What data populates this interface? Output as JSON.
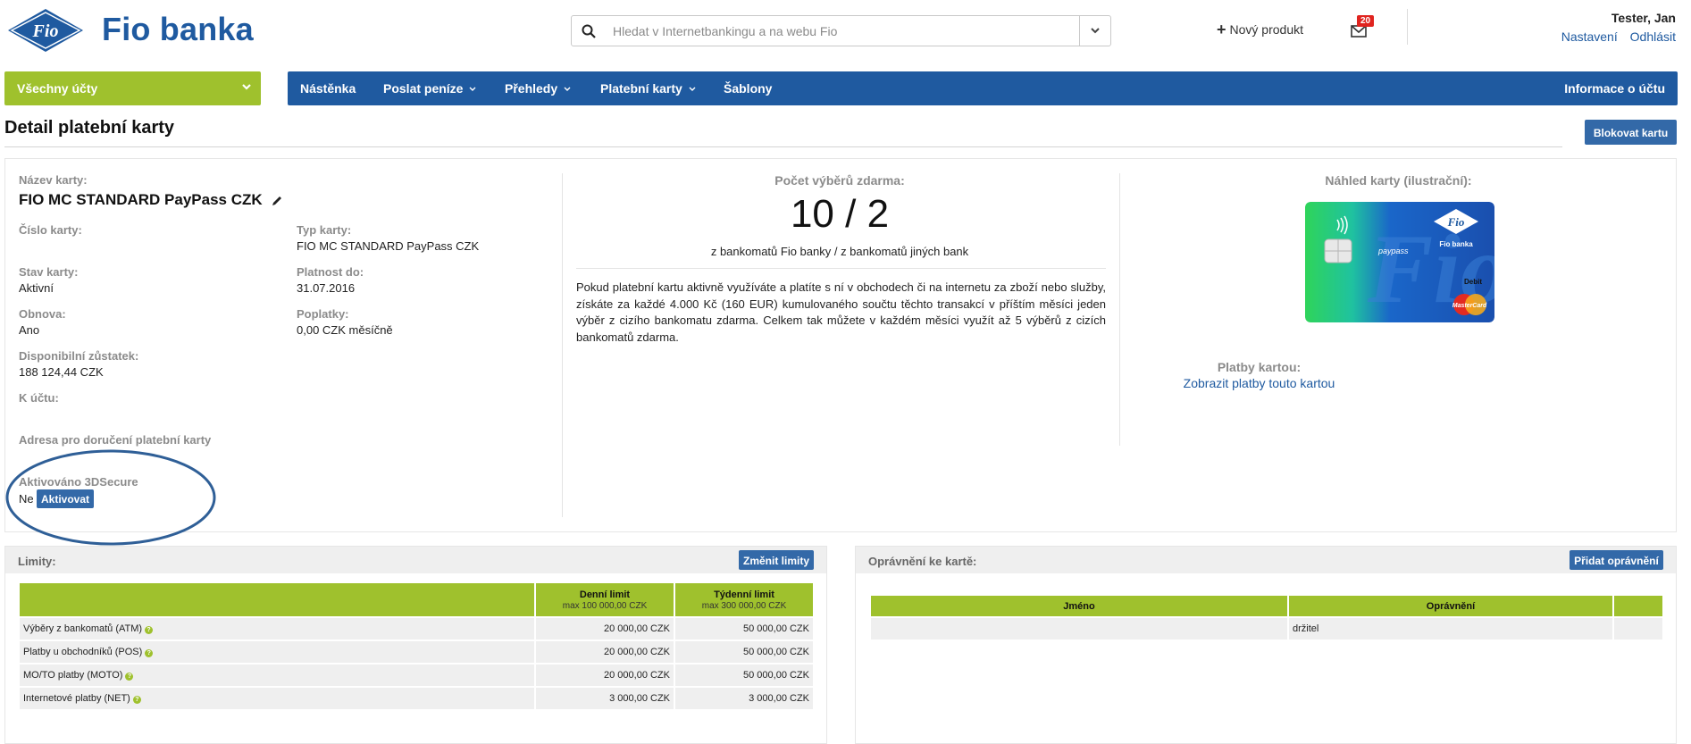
{
  "header": {
    "brand": "Fio banka",
    "logo_text": "Fio",
    "search_placeholder": "Hledat v Internetbankingu a na webu Fio",
    "new_product": "Nový produkt",
    "notifications_count": "20",
    "user_name": "Tester, Jan",
    "settings_link": "Nastavení",
    "logout_link": "Odhlásit"
  },
  "nav": {
    "accounts": "Všechny účty",
    "items": [
      "Nástěnka",
      "Poslat peníze",
      "Přehledy",
      "Platební karty",
      "Šablony"
    ],
    "account_info": "Informace o účtu"
  },
  "page": {
    "title": "Detail platební karty",
    "block_button": "Blokovat kartu"
  },
  "card": {
    "name_label": "Název karty:",
    "name": "FIO MC STANDARD PayPass CZK",
    "number_label": "Číslo karty:",
    "number": "",
    "type_label": "Typ karty:",
    "type": "FIO MC STANDARD PayPass CZK",
    "state_label": "Stav karty:",
    "state": "Aktivní",
    "valid_label": "Platnost do:",
    "valid": "31.07.2016",
    "renew_label": "Obnova:",
    "renew": "Ano",
    "fees_label": "Poplatky:",
    "fees": "0,00 CZK měsíčně",
    "balance_label": "Disponibilní zůstatek:",
    "balance": "188 124,44 CZK",
    "account_label": "K účtu:",
    "address_label": "Adresa pro doručení platební karty",
    "secure_label": "Aktivováno 3DSecure",
    "secure_value": "Ne",
    "activate_button": "Aktivovat"
  },
  "withdrawals": {
    "label": "Počet výběrů zdarma:",
    "count": "10 / 2",
    "sub": "z bankomatů Fio banky / z bankomatů jiných bank",
    "description": "Pokud platební kartu aktivně využíváte a platíte s ní v obchodech či na internetu za zboží nebo služby, získáte za každé 4.000 Kč (160 EUR) kumulovaného součtu těchto transakcí v příštím měsíci jeden výběr z cizího bankomatu zdarma. Celkem tak můžete v každém měsíci využít až 5 výběrů z cizích bankomatů zdarma."
  },
  "preview": {
    "label": "Náhled karty (ilustrační):",
    "card_brand": "Fio",
    "card_bank": "Fio banka",
    "card_paypass": "paypass",
    "card_debit": "Debit",
    "card_mastercard": "MasterCard",
    "payments_label": "Platby kartou:",
    "payments_link": "Zobrazit platby touto kartou"
  },
  "limits": {
    "title": "Limity:",
    "change_button": "Změnit limity",
    "columns": [
      {
        "title": "Denní limit",
        "sub": "max 100 000,00 CZK"
      },
      {
        "title": "Týdenní limit",
        "sub": "max 300 000,00 CZK"
      }
    ],
    "rows": [
      {
        "label": "Výběry z bankomatů (ATM)",
        "daily": "20 000,00 CZK",
        "weekly": "50 000,00 CZK"
      },
      {
        "label": "Platby u obchodníků (POS)",
        "daily": "20 000,00 CZK",
        "weekly": "50 000,00 CZK"
      },
      {
        "label": "MO/TO platby (MOTO)",
        "daily": "20 000,00 CZK",
        "weekly": "50 000,00 CZK"
      },
      {
        "label": "Internetové platby (NET)",
        "daily": "3 000,00 CZK",
        "weekly": "3 000,00 CZK"
      }
    ],
    "help_glyph": "?"
  },
  "permissions": {
    "title": "Oprávnění ke kartě:",
    "add_button": "Přidat oprávnění",
    "columns": [
      "Jméno",
      "Oprávnění"
    ],
    "rows": [
      {
        "name": "",
        "role": "držitel"
      }
    ]
  },
  "colors": {
    "brand_blue": "#1f5aa0",
    "brand_green": "#9fc12d",
    "button_blue": "#3369a8",
    "badge_red": "#e0241f"
  }
}
